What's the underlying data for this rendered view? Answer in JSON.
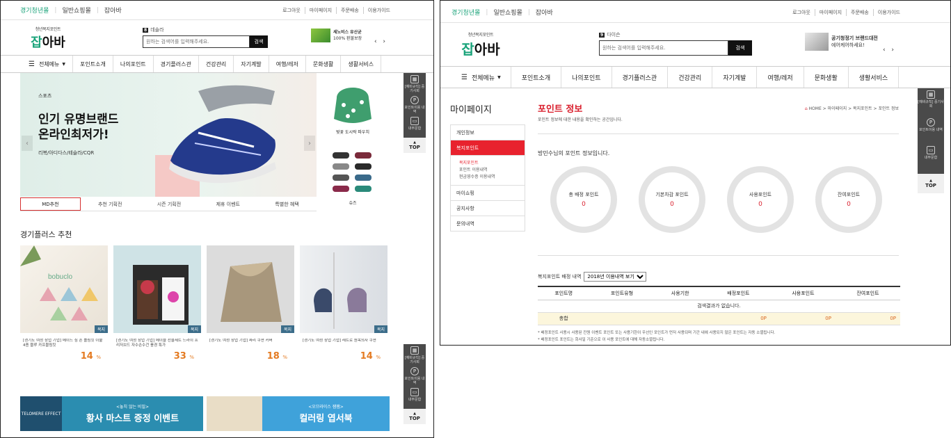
{
  "header": {
    "tabs": [
      "경기청년몰",
      "일반쇼핑몰",
      "잡아바"
    ],
    "util_links": [
      "로그아웃",
      "마이페이지",
      "주문배송",
      "이용가이드"
    ],
    "logo_small": "청년복지포인트",
    "logo_big_a": "잡",
    "logo_big_b": "아바",
    "search_hot_num_1": "8",
    "search_hot_text_1": "데솔라",
    "search_hot_num_2": "9",
    "search_hot_text_2": "다이슨",
    "search_placeholder": "원하는 검색어를 입력해주세요.",
    "search_button": "검색",
    "promo_1_line1": "세노비스 유산균",
    "promo_1_line2": "100% 환불보장",
    "promo_2_line1": "공기청정기 브랜드대전",
    "promo_2_line2": "에어케어하세요!",
    "promo_arrows": "‹ ›"
  },
  "gnb": {
    "all_menu": "전체메뉴",
    "items": [
      "포인트소개",
      "나의포인트",
      "경기플러스관",
      "건강관리",
      "자기계발",
      "여행/레저",
      "문화생활",
      "생활서비스"
    ]
  },
  "quick": {
    "item1": "[예비규칙] 중기사회",
    "item2": "포인트이용 내역",
    "item3": "내무문합",
    "top": "TOP"
  },
  "banner": {
    "category": "스포츠",
    "headline_1": "인기 유명브랜드",
    "headline_2": "온라인최저가!",
    "brands": "리복/아디다스/테슬라/CQR",
    "side_1_caption": "벚꽃 도시락 파우치",
    "side_2_caption": "슈즈",
    "tabs": [
      "MD추천",
      "추천 기획전",
      "시즌 기획전",
      "제휴 이벤트",
      "특별한 혜택"
    ]
  },
  "recommend": {
    "title": "경기플러스 추천",
    "products": [
      {
        "tag": "복지",
        "name": "[경기도 여성 창업 기업] 메이드 심 흔 틀림킷 이불 4종 블루 카프블링킷",
        "pct": "14",
        "unit": "%"
      },
      {
        "tag": "복지",
        "name": "[경기도 여성 창업 기업] 메이블 선물세트 드라이 프리저브드 자수손수건 풍경 특가",
        "pct": "33",
        "unit": "%"
      },
      {
        "tag": "복지",
        "name": "[경기도 여성 창업 기업] 싸리 쿠션 커버",
        "pct": "18",
        "unit": "%"
      },
      {
        "tag": "복지",
        "name": "[경기도 여성 창업 기업] 레트로 원목의자 쿠션",
        "pct": "14",
        "unit": "%"
      }
    ]
  },
  "events": [
    {
      "small": "TELOMERE EFFECT",
      "t1": "<놓치 않는 비밀>",
      "t2": "황사 마스트 증정 이벤트"
    },
    {
      "t1": "<오므라이스 잼잼>",
      "t2": "컬러링 엽서북"
    }
  ],
  "mypage": {
    "lnb_title": "마이페이지",
    "lnb": {
      "info": "개인정보",
      "welfare": "복지포인트",
      "subs": [
        "복지포인트",
        "포인트 이용내역",
        "현금영수증 이용내역"
      ],
      "myshop": "마이쇼핑",
      "notice": "공지사항",
      "inquiry": "문의내역"
    },
    "title": "포인트 정보",
    "desc": "포인트 정보에 대한 내용을 확인하는 공간입니다.",
    "crumb_home": "HOME",
    "crumb": "> 마이페이지 > 복지포인트 > 포인트 정보",
    "greet": "방민수님의 포인트 정보입니다.",
    "circles": [
      {
        "label": "총 배정 포인트",
        "value": "0"
      },
      {
        "label": "기본차감 포인트",
        "value": "0"
      },
      {
        "label": "사용포인트",
        "value": "0"
      },
      {
        "label": "잔여포인트",
        "value": "0"
      }
    ],
    "history_label": "복지포인트 배정 내역",
    "history_select": "2018년 이용내역 보기",
    "table": {
      "headers": [
        "포인트명",
        "포인트유형",
        "사용기한",
        "배정포인트",
        "사용포인트",
        "잔여포인트"
      ],
      "empty": "검색결과가 없습니다.",
      "sum_label": "총합",
      "sum_values": [
        "0P",
        "0P",
        "0P"
      ]
    },
    "notes": [
      "* 배정포인트 사용시 사용된 잔원 이벤트 포인트 또는 사용기한이 우선인 포인트가 먼저 사용되며 기간 내에 사용되지 않은 포인트는 자동 소멸됩니다.",
      "* 배정포인트 포인트는 회사일 기준으로 이 사용 포인트에 대해 자동소멸됩니다."
    ]
  },
  "colors": {
    "accent_red": "#e8222e",
    "green": "#1aa37a",
    "orange": "#e47b22"
  }
}
